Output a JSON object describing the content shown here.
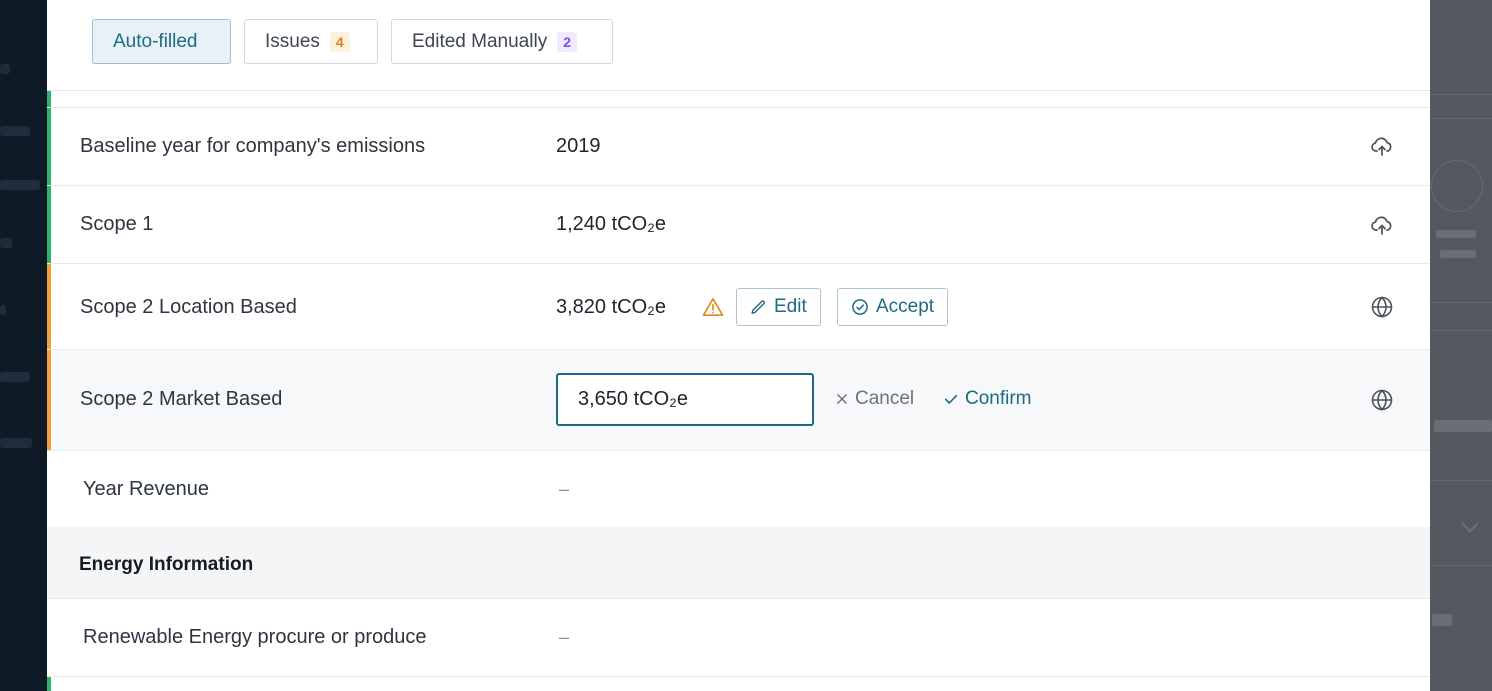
{
  "tabs": [
    {
      "label": "Auto-filled",
      "count": null
    },
    {
      "label": "Issues",
      "count": "4"
    },
    {
      "label": "Edited Manually",
      "count": "2"
    }
  ],
  "rows": {
    "baseline": {
      "label": "Baseline year for company's emissions",
      "value": "2019"
    },
    "scope1": {
      "label": "Scope 1",
      "value": "1,240 tCO₂e"
    },
    "scope2_location": {
      "label": "Scope 2 Location Based",
      "value": "3,820 tCO₂e",
      "edit_label": "Edit",
      "accept_label": "Accept"
    },
    "scope2_market": {
      "label": "Scope 2 Market Based",
      "input_value": "3,650 tCO₂e",
      "cancel_label": "Cancel",
      "confirm_label": "Confirm"
    },
    "year_revenue": {
      "label": "Year Revenue",
      "value": "–"
    },
    "renewable": {
      "label": "Renewable Energy procure or produce",
      "value": "–"
    }
  },
  "section": {
    "title": "Energy Information"
  },
  "icons": {
    "upload": "cloud-upload-icon",
    "globe": "globe-icon",
    "warning": "warning-icon",
    "pencil": "pencil-icon",
    "check_circle": "check-circle-icon",
    "close": "close-icon",
    "check": "check-icon"
  },
  "colors": {
    "accent": "#1d6b84",
    "green_bar": "#2fb36b",
    "orange_bar": "#eea13b",
    "warning": "#e08a1e"
  }
}
